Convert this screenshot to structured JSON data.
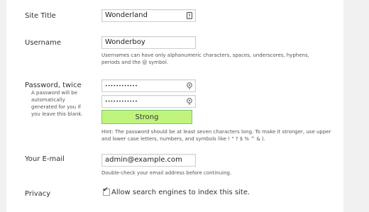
{
  "site_title": {
    "label": "Site Title",
    "value": "Wonderland",
    "icon": "info-icon"
  },
  "username": {
    "label": "Username",
    "value": "Wonderboy",
    "description": "Usernames can have only alphanumeric characters, spaces, underscores, hyphens, periods and the @ symbol."
  },
  "password": {
    "label": "Password, twice",
    "description": "A password will be automatically generated for you if you leave this blank.",
    "value_1": "••••••••••••",
    "value_2": "••••••••••••",
    "icon": "key-icon",
    "strength": "Strong",
    "strength_color": "#bff47e",
    "hint": "Hint: The password should be at least seven characters long. To make it stronger, use upper and lower case letters, numbers, and symbols like ! \" ? $ % ^ & )."
  },
  "email": {
    "label": "Your E-mail",
    "value": "admin@example.com",
    "description": "Double-check your email address before continuing."
  },
  "privacy": {
    "label": "Privacy",
    "checkbox_label": "Allow search engines to index this site.",
    "checked": true
  }
}
